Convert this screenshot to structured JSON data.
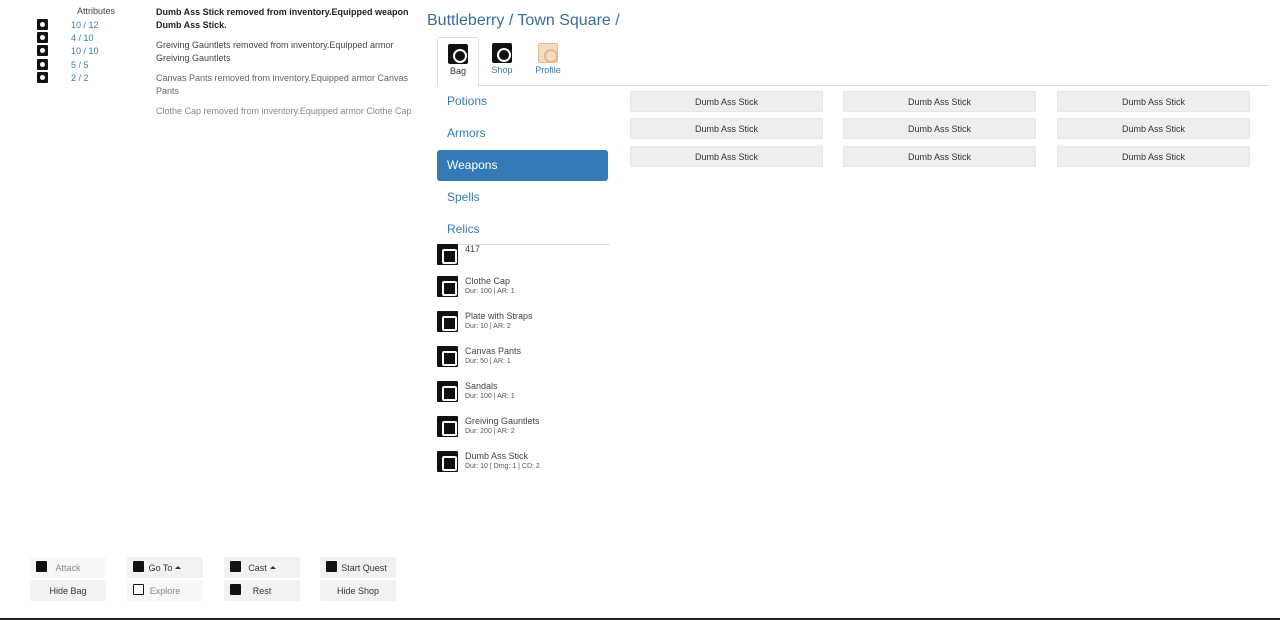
{
  "attributes": {
    "title": "Attributes",
    "rows": [
      {
        "icon": "heart-icon",
        "value": "10 / 12"
      },
      {
        "icon": "eye-icon",
        "value": "4 / 10"
      },
      {
        "icon": "boot-icon",
        "value": "10 / 10"
      },
      {
        "icon": "skull-icon",
        "value": "5 / 5"
      },
      {
        "icon": "armor-icon",
        "value": "2 / 2"
      }
    ]
  },
  "log": {
    "messages": [
      {
        "text": "Dumb Ass Stick removed from inventory.Equipped weapon Dumb Ass Stick.",
        "color": "#222222",
        "weight": "bold"
      },
      {
        "text": "Greiving Gauntlets removed from inventory.Equipped armor Greiving Gauntlets",
        "color": "#444444",
        "weight": "normal"
      },
      {
        "text": "Canvas Pants removed from inventory.Equipped armor Canvas Pants",
        "color": "#666666",
        "weight": "normal"
      },
      {
        "text": "Clothe Cap removed from inventory.Equipped armor Clothe Cap",
        "color": "#888888",
        "weight": "normal"
      }
    ]
  },
  "location": "Buttleberry / Town Square /",
  "tabs": [
    {
      "label": "Bag",
      "icon": "bag-icon"
    },
    {
      "label": "Shop",
      "icon": "shop-icon"
    },
    {
      "label": "Profile",
      "icon": "profile-icon"
    }
  ],
  "categories": [
    "Potions",
    "Armors",
    "Weapons",
    "Spells",
    "Relics"
  ],
  "active_category": "Weapons",
  "inventory": {
    "gold": {
      "icon": "gold-icon",
      "value": "417"
    },
    "items": [
      {
        "name": "Clothe Cap",
        "stats": "Dur: 100 | AR: 1",
        "icon": "helmet-icon"
      },
      {
        "name": "Plate with Straps",
        "stats": "Dur: 10 | AR: 2",
        "icon": "chestplate-icon"
      },
      {
        "name": "Canvas Pants",
        "stats": "Dur: 50 | AR: 1",
        "icon": "pants-icon"
      },
      {
        "name": "Sandals",
        "stats": "Dur: 100 | AR: 1",
        "icon": "sandals-icon"
      },
      {
        "name": "Greiving Gauntlets",
        "stats": "Dur: 200 | AR: 2",
        "icon": "shield-icon"
      },
      {
        "name": "Dumb Ass Stick",
        "stats": "Dur: 10 | Dmg: 1 | CD: 2",
        "icon": "sword-icon"
      }
    ]
  },
  "shop": {
    "items": [
      "Dumb Ass Stick",
      "Dumb Ass Stick",
      "Dumb Ass Stick",
      "Dumb Ass Stick",
      "Dumb Ass Stick",
      "Dumb Ass Stick",
      "Dumb Ass Stick",
      "Dumb Ass Stick",
      "Dumb Ass Stick"
    ]
  },
  "actions": {
    "attack": "Attack",
    "hide_bag": "Hide Bag",
    "go_to": "Go To",
    "explore": "Explore",
    "cast": "Cast",
    "rest": "Rest",
    "start_quest": "Start Quest",
    "hide_shop": "Hide Shop"
  },
  "colors": {
    "accent": "#337ab7",
    "link": "#3a7ab0",
    "button_bg": "#eeeeee"
  }
}
